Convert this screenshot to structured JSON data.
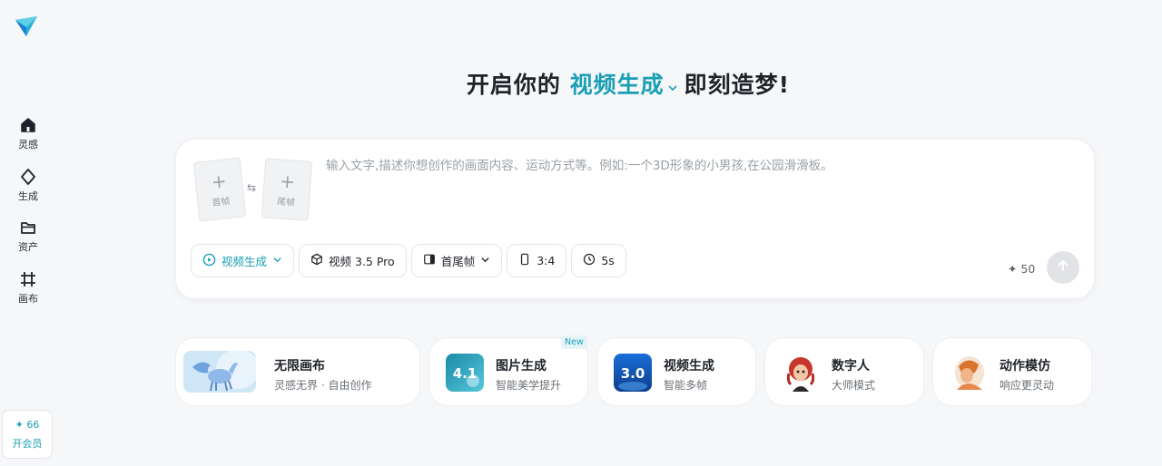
{
  "sidebar": {
    "items": [
      {
        "label": "灵感",
        "icon": "home-icon"
      },
      {
        "label": "生成",
        "icon": "diamond-icon"
      },
      {
        "label": "资产",
        "icon": "folder-icon"
      },
      {
        "label": "画布",
        "icon": "canvas-grid-icon"
      }
    ],
    "credits": "66",
    "vip_label": "开会员"
  },
  "headline": {
    "prefix": "开启你的",
    "mode": "视频生成",
    "suffix": "即刻造梦!"
  },
  "prompt": {
    "first_frame_label": "首帧",
    "last_frame_label": "尾帧",
    "placeholder": "输入文字,描述你想创作的画面内容、运动方式等。例如:一个3D形象的小男孩,在公园滑滑板。",
    "value": ""
  },
  "toolbar": {
    "mode_label": "视频生成",
    "model_label": "视频 3.5 Pro",
    "frames_label": "首尾帧",
    "ratio_label": "3:4",
    "duration_label": "5s",
    "credit_cost": "50"
  },
  "features": [
    {
      "title": "无限画布",
      "subtitle": "灵感无界 · 自由创作",
      "badge": ""
    },
    {
      "title": "图片生成",
      "subtitle": "智能美学提升",
      "badge": "New"
    },
    {
      "title": "视频生成",
      "subtitle": "智能多帧",
      "badge": ""
    },
    {
      "title": "数字人",
      "subtitle": "大师模式",
      "badge": ""
    },
    {
      "title": "动作模仿",
      "subtitle": "响应更灵动",
      "badge": ""
    }
  ],
  "thumb_text": {
    "image_gen": "4.1",
    "video_gen": "3.0"
  },
  "colors": {
    "accent": "#1a9fb5",
    "background": "#f6f7f9",
    "send_disabled": "#e1e3e6"
  }
}
